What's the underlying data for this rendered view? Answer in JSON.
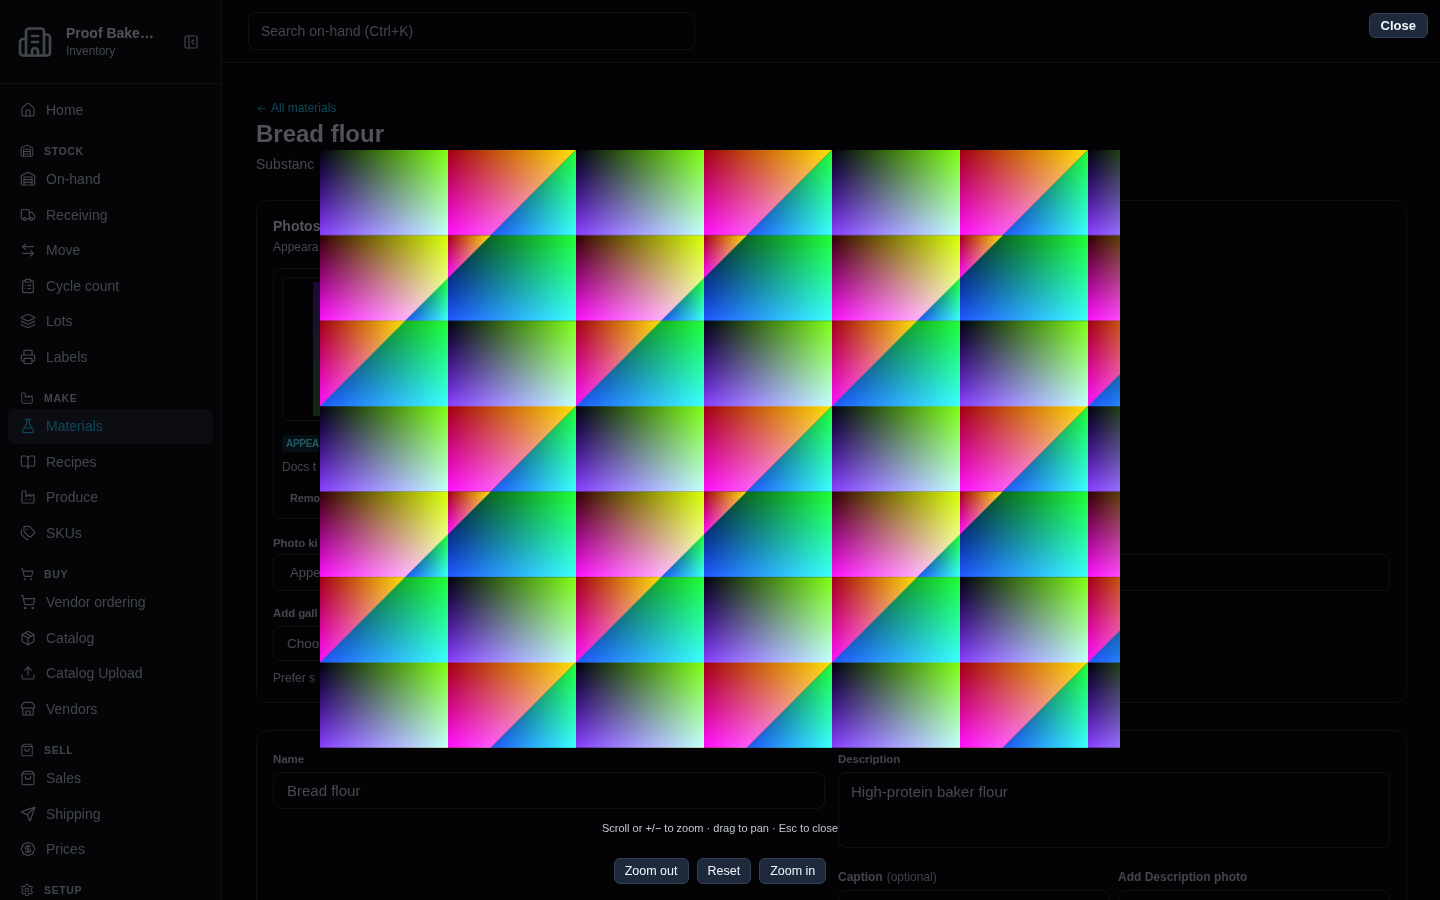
{
  "sidebar": {
    "brand": {
      "name": "Proof Bake…",
      "subtitle": "Inventory"
    },
    "home": {
      "label": "Home",
      "selected": false
    },
    "sections": [
      {
        "title": "STOCK",
        "items": [
          {
            "label": "On-hand",
            "selected": false
          },
          {
            "label": "Receiving",
            "selected": false
          },
          {
            "label": "Move",
            "selected": false
          },
          {
            "label": "Cycle count",
            "selected": false
          },
          {
            "label": "Lots",
            "selected": false
          },
          {
            "label": "Labels",
            "selected": false
          }
        ]
      },
      {
        "title": "MAKE",
        "items": [
          {
            "label": "Materials",
            "selected": true
          },
          {
            "label": "Recipes",
            "selected": false
          },
          {
            "label": "Produce",
            "selected": false
          },
          {
            "label": "SKUs",
            "selected": false
          }
        ]
      },
      {
        "title": "BUY",
        "items": [
          {
            "label": "Vendor ordering",
            "selected": false
          },
          {
            "label": "Catalog",
            "selected": false
          },
          {
            "label": "Catalog Upload",
            "selected": false
          },
          {
            "label": "Vendors",
            "selected": false
          }
        ]
      },
      {
        "title": "SELL",
        "items": [
          {
            "label": "Sales",
            "selected": false
          },
          {
            "label": "Shipping",
            "selected": false
          },
          {
            "label": "Prices",
            "selected": false
          }
        ]
      },
      {
        "title": "SETUP"
      }
    ]
  },
  "topbar": {
    "search": {
      "placeholder": "Search on-hand (Ctrl+K)"
    }
  },
  "page": {
    "back_link": "All materials",
    "title": "Bread flour",
    "subtitle": "Substanc"
  },
  "photos_card": {
    "title": "Photos",
    "subtitle": "Appeara",
    "gallery": [
      {
        "tag": "APPEA",
        "caption": "Docs t",
        "remove_button": "Remo"
      }
    ],
    "photo_kind": {
      "label": "Photo ki",
      "value": "Appe"
    },
    "add_gallery": {
      "label": "Add gall",
      "button": "Choo"
    },
    "hint": "Prefer s"
  },
  "details_card": {
    "name": {
      "label": "Name",
      "value": "Bread flour"
    },
    "description": {
      "label": "Description",
      "value": "High-protein baker flour"
    },
    "caption": {
      "label": "Caption",
      "note": "(optional)"
    },
    "description_photo": {
      "label": "Add Description photo"
    }
  },
  "lightbox": {
    "close_button": "Close",
    "hint": "Scroll or +/− to zoom · drag to pan · Esc to close",
    "buttons": [
      "Zoom out",
      "Reset",
      "Zoom in"
    ]
  }
}
